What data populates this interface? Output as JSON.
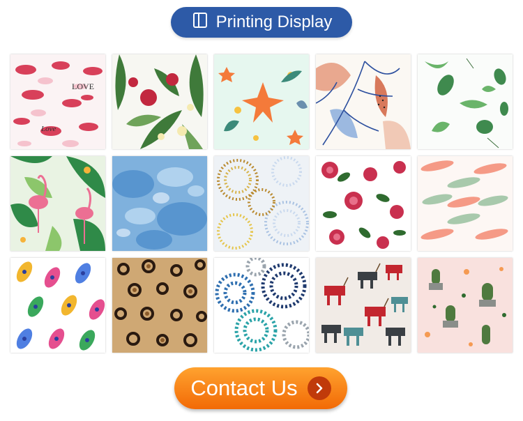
{
  "header": {
    "title": "Printing Display",
    "icon": "book-icon",
    "color": "#2d5aa7"
  },
  "tiles": [
    {
      "name": "lips-love-pattern",
      "words": [
        "LOVE",
        "Love"
      ]
    },
    {
      "name": "tropical-hibiscus-pattern"
    },
    {
      "name": "orange-lily-pattern"
    },
    {
      "name": "abstract-leaves-pattern"
    },
    {
      "name": "green-leaves-pattern"
    },
    {
      "name": "flamingo-pattern"
    },
    {
      "name": "blue-watercolor-pattern"
    },
    {
      "name": "gold-chrysanthemum-pattern"
    },
    {
      "name": "red-roses-pattern"
    },
    {
      "name": "feather-pattern"
    },
    {
      "name": "peacock-feather-pattern"
    },
    {
      "name": "leopard-print-pattern"
    },
    {
      "name": "blue-dahlia-pattern"
    },
    {
      "name": "reindeer-pattern"
    },
    {
      "name": "cactus-pattern"
    }
  ],
  "contact": {
    "label": "Contact Us",
    "icon": "chevron-right-icon",
    "color": "#f57f12"
  }
}
